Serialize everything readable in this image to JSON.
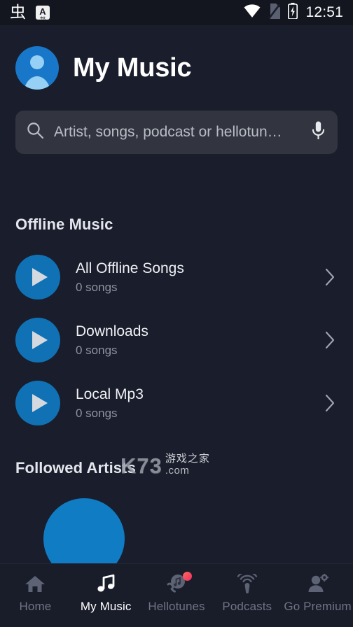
{
  "status_bar": {
    "time": "12:51",
    "left_icons": [
      {
        "name": "app-logo-glyph-icon",
        "label": "虫"
      },
      {
        "name": "keyboard-language-icon",
        "label": "A",
        "sub_label": "中文"
      }
    ],
    "right_icons": [
      {
        "name": "wifi-icon"
      },
      {
        "name": "no-sim-icon"
      },
      {
        "name": "battery-charging-icon"
      }
    ]
  },
  "header": {
    "avatar_name": "user-avatar",
    "title": "My Music"
  },
  "search": {
    "placeholder": "Artist, songs, podcast or hellotun…",
    "value": "",
    "search_icon": "search-icon",
    "mic_icon": "microphone-icon"
  },
  "sections": {
    "offline": {
      "title": "Offline Music",
      "items": [
        {
          "title": "All Offline Songs",
          "subtitle": "0 songs"
        },
        {
          "title": "Downloads",
          "subtitle": "0 songs"
        },
        {
          "title": "Local Mp3",
          "subtitle": "0 songs"
        }
      ]
    },
    "followed_artists": {
      "title": "Followed Artists"
    }
  },
  "watermark": {
    "brand": "K73",
    "chinese": "游戏之家",
    "domain": ".com"
  },
  "bottom_nav": {
    "items": [
      {
        "label": "Home",
        "icon": "home-icon",
        "active": false,
        "badge": false
      },
      {
        "label": "My Music",
        "icon": "music-note-icon",
        "active": true,
        "badge": false
      },
      {
        "label": "Hellotunes",
        "icon": "hellotune-phone-icon",
        "active": false,
        "badge": true
      },
      {
        "label": "Podcasts",
        "icon": "podcast-mic-icon",
        "active": false,
        "badge": false
      },
      {
        "label": "Go Premium",
        "icon": "premium-person-gear-icon",
        "active": false,
        "badge": false
      }
    ]
  },
  "colors": {
    "background": "#1a1d2b",
    "status_bar": "#13161f",
    "search_field": "#32353f",
    "accent_blue": "#1071b4",
    "avatar_blue": "#1877c9",
    "nav_bar": "#191c29",
    "badge_red": "#f0435b",
    "text_primary": "#eef0f4",
    "text_secondary": "#8e93a0"
  }
}
